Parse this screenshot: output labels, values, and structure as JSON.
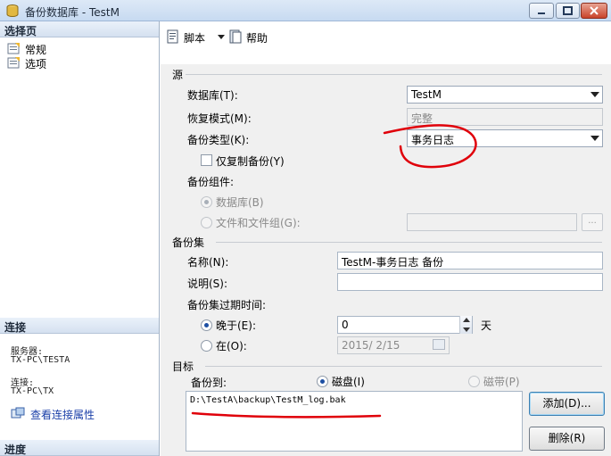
{
  "window": {
    "title": "备份数据库 - TestM"
  },
  "left_pane": {
    "select_page_header": "选择页",
    "pages": [
      {
        "label": "常规"
      },
      {
        "label": "选项"
      }
    ],
    "connection_header": "连接",
    "server_label": "服务器:",
    "server_value": "TX-PC\\TESTA",
    "connection_label": "连接:",
    "connection_value": "TX-PC\\TX",
    "view_connection_link": "查看连接属性",
    "progress_header": "进度"
  },
  "toolbar": {
    "script_label": "脚本",
    "help_label": "帮助"
  },
  "source": {
    "section_label": "源",
    "database_label": "数据库(T):",
    "database_value": "TestM",
    "recovery_model_label": "恢复模式(M):",
    "recovery_model_value": "完整",
    "backup_type_label": "备份类型(K):",
    "backup_type_value": "事务日志",
    "copy_only_label": "仅复制备份(Y)",
    "copy_only_checked": false,
    "component_label": "备份组件:",
    "component_database_label": "数据库(B)",
    "component_files_label": "文件和文件组(G):",
    "ellipsis_label": "..."
  },
  "backup_set": {
    "section_label": "备份集",
    "name_label": "名称(N):",
    "name_value": "TestM-事务日志  备份",
    "description_label": "说明(S):",
    "description_value": "",
    "expire_label": "备份集过期时间:",
    "after_label": "晚于(E):",
    "after_value": "0",
    "days_label": "天",
    "on_label": "在(O):",
    "on_value": "2015/ 2/15"
  },
  "destination": {
    "section_label": "目标",
    "backup_to_label": "备份到:",
    "disk_label": "磁盘(I)",
    "tape_label": "磁带(P)",
    "paths": [
      "D:\\TestA\\backup\\TestM_log.bak"
    ],
    "add_button": "添加(D)...",
    "remove_button": "删除(R)"
  },
  "annotation_color": "#e0000a"
}
